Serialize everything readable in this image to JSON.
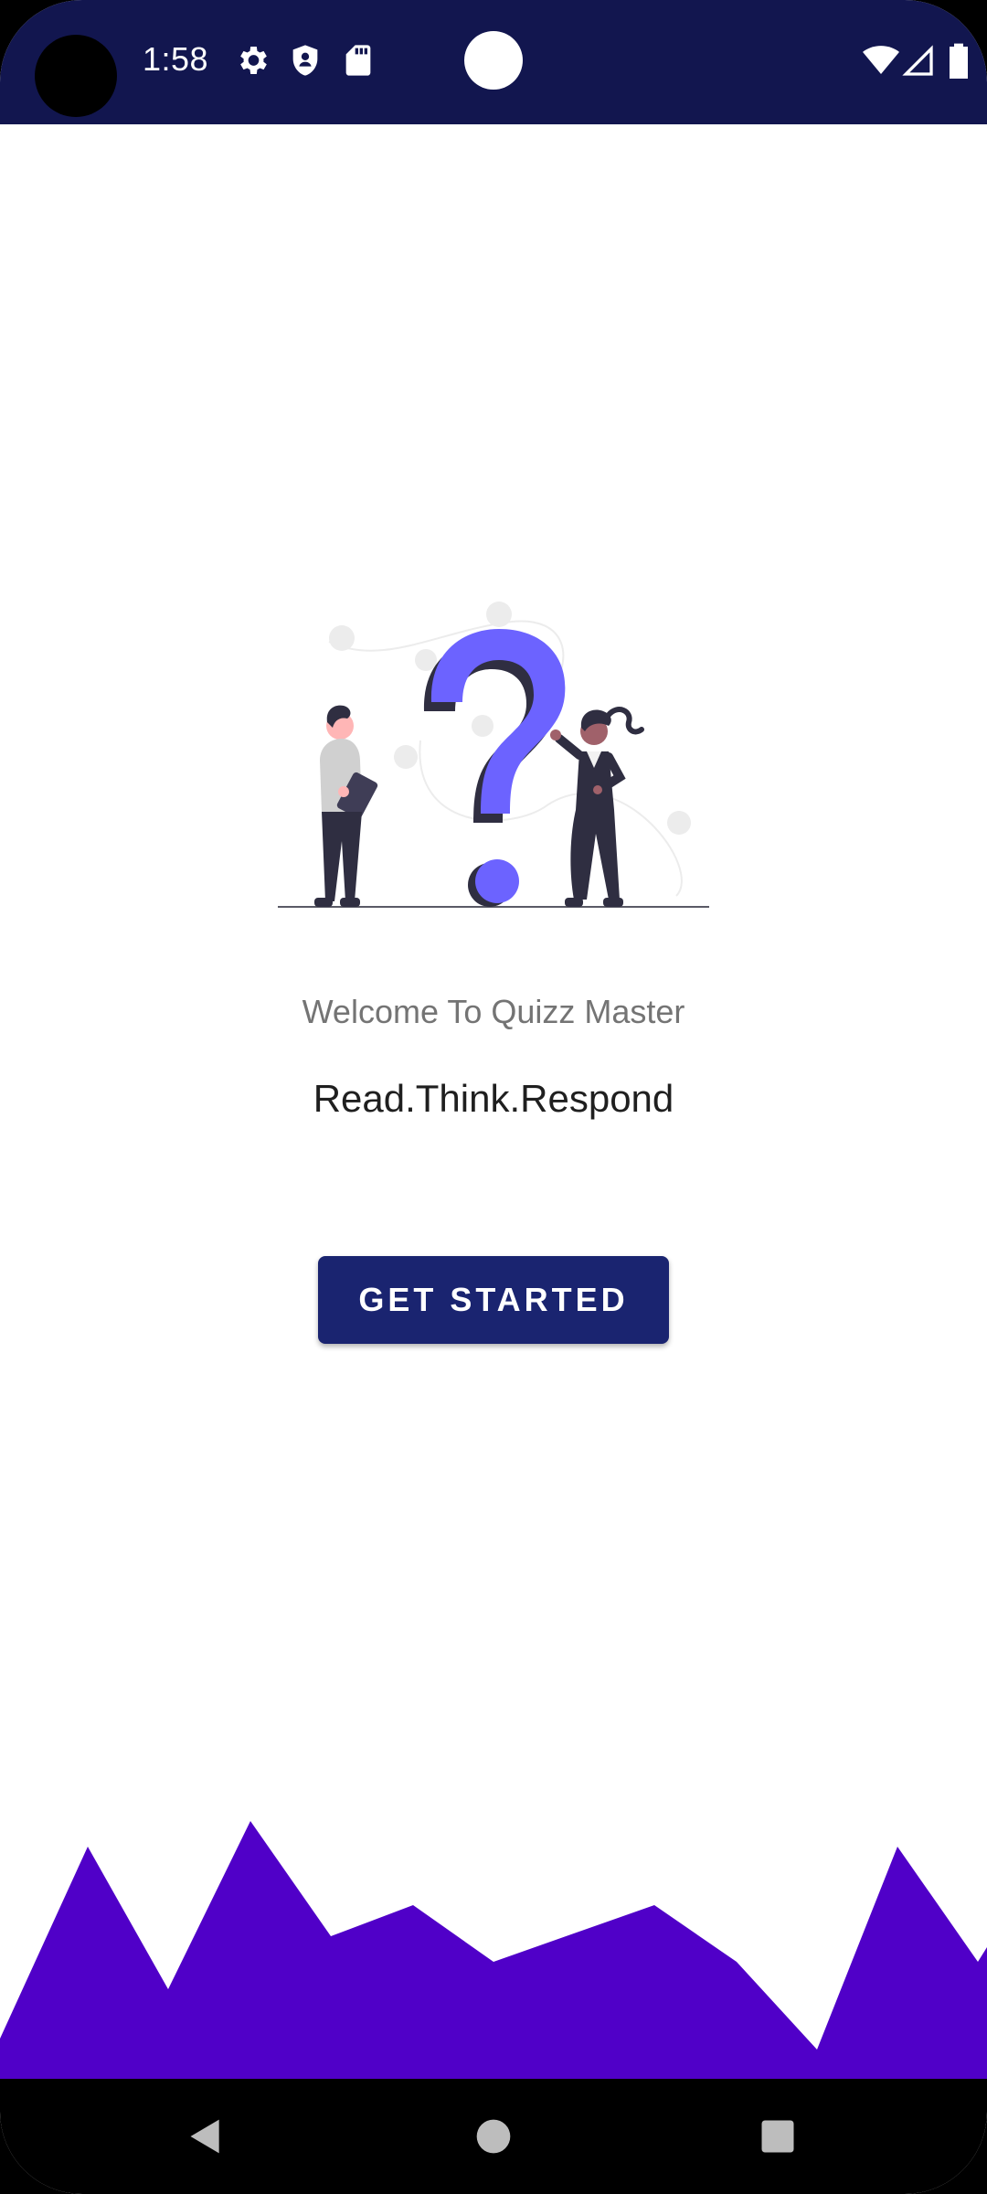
{
  "status_bar": {
    "time": "1:58",
    "left_icons": [
      "settings-icon",
      "shield-icon",
      "sd-card-icon"
    ],
    "right_icons": [
      "wifi-icon",
      "signal-icon",
      "battery-icon"
    ],
    "background": "#12164f"
  },
  "welcome": {
    "title": "Welcome To Quizz Master",
    "tagline": "Read.Think.Respond"
  },
  "cta": {
    "label": "GET STARTED",
    "color": "#1a2470"
  },
  "decoration": {
    "mountain_color": "#5000c8",
    "question_mark_color": "#6c63ff"
  },
  "nav_bar": {
    "buttons": [
      "back-icon",
      "home-icon",
      "recents-icon"
    ]
  }
}
